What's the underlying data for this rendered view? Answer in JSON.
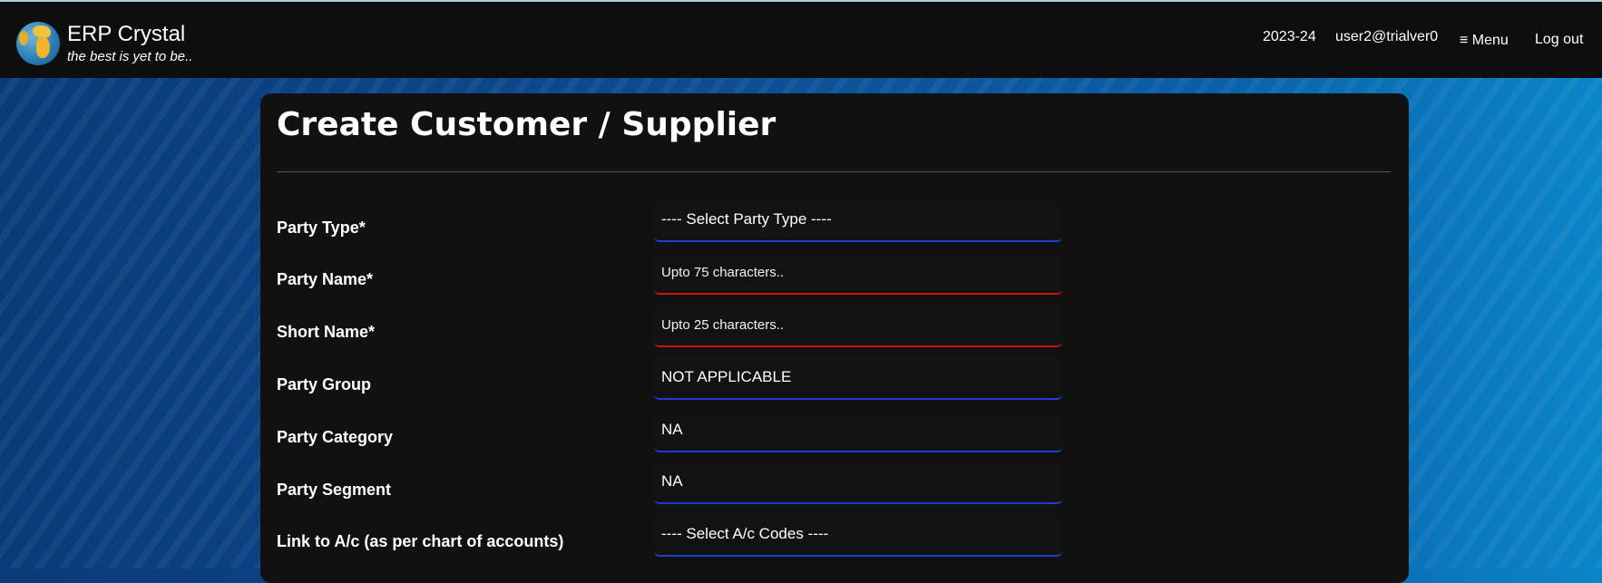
{
  "app": {
    "name": "ERP Crystal",
    "tagline": "the best is yet to be..",
    "year": "2023-24",
    "user": "user2@trialver0",
    "menu_label": "≡ Menu",
    "logout_label": "Log out"
  },
  "page": {
    "title": "Create Customer / Supplier"
  },
  "form": {
    "party_type": {
      "label": "Party Type*",
      "value": "---- Select Party Type ----"
    },
    "party_name": {
      "label": "Party Name*",
      "placeholder": "Upto 75 characters.."
    },
    "short_name": {
      "label": "Short Name*",
      "placeholder": "Upto 25 characters.."
    },
    "party_group": {
      "label": "Party Group",
      "value": "NOT APPLICABLE"
    },
    "party_category": {
      "label": "Party Category",
      "value": "NA"
    },
    "party_segment": {
      "label": "Party Segment",
      "value": "NA"
    },
    "link_ac": {
      "label": "Link to A/c (as per chart of accounts)",
      "value": "---- Select A/c Codes ----"
    }
  },
  "colors": {
    "header_bg": "#0e0e0e",
    "card_bg": "#111111",
    "required_underline": "#cc1111",
    "optional_underline": "#1a3fd1"
  }
}
